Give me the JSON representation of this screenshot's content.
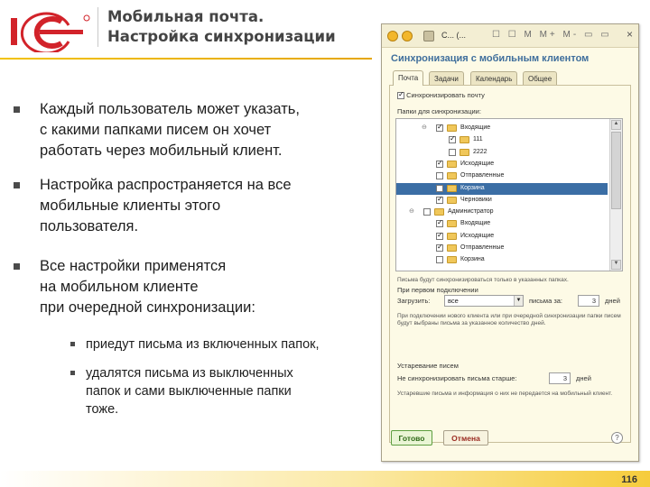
{
  "slide": {
    "title_line1": "Мобильная почта.",
    "title_line2": "Настройка синхронизации",
    "bullets": [
      "Каждый пользователь может указать,\nс какими папками писем он хочет\nработать через мобильный клиент.",
      "Настройка распространяется на все\nмобильные клиенты этого\nпользователя.",
      "Все настройки применятся\nна мобильном клиенте\nпри очередной синхронизации:"
    ],
    "sub_bullets": [
      "приедут письма из включенных папок,",
      "удалятся письма из выключенных\nпапок и сами выключенные папки\nтоже."
    ],
    "page_number": "116"
  },
  "window": {
    "title": "С... (...",
    "toolbar_icons": "☐ ☐ M M+ M- ▭ ▭",
    "form_title": "Синхронизация с мобильным клиентом",
    "tabs": [
      "Почта",
      "Задачи",
      "Календарь",
      "Общее"
    ],
    "sync_mail_label": "Синхронизировать почту",
    "folders_label": "Папки для синхронизации:",
    "tree": [
      {
        "label": "Входящие",
        "checked": true,
        "expander": "⊖",
        "selected": false
      },
      {
        "label": "111",
        "checked": true,
        "expander": "",
        "selected": false
      },
      {
        "label": "2222",
        "checked": false,
        "expander": "",
        "selected": false
      },
      {
        "label": "Исходящие",
        "checked": true,
        "expander": "",
        "selected": false
      },
      {
        "label": "Отправленные",
        "checked": false,
        "expander": "",
        "selected": false
      },
      {
        "label": "Корзина",
        "checked": false,
        "expander": "",
        "selected": true
      },
      {
        "label": "Черновики",
        "checked": true,
        "expander": "",
        "selected": false
      },
      {
        "label": "Администратор",
        "checked": false,
        "expander": "⊖",
        "selected": false
      },
      {
        "label": "Входящие",
        "checked": true,
        "expander": "",
        "selected": false
      },
      {
        "label": "Исходящие",
        "checked": true,
        "expander": "",
        "selected": false
      },
      {
        "label": "Отправленные",
        "checked": true,
        "expander": "",
        "selected": false
      },
      {
        "label": "Корзина",
        "checked": false,
        "expander": "",
        "selected": false
      }
    ],
    "tree_note": "Письма будут синхронизироваться только в указанных папках.",
    "first_connect_section": "При первом подключении",
    "load_label": "Загрузить:",
    "load_value": "все",
    "letters_for_label": "письма за:",
    "letters_days_value": "3",
    "days_label": "дней",
    "first_connect_note": "При подключении нового клиента или при очередной синхронизации папки писем будут выбраны письма за указанное количество дней.",
    "obsolete_section": "Устаревание писем",
    "no_sync_older_label": "Не синхронизировать письма старше:",
    "no_sync_days_value": "3",
    "obsolete_note": "Устаревшие письма и информация о них не передается на мобильный клиент.",
    "ok_button": "Готово",
    "cancel_button": "Отмена",
    "help_button": "?"
  },
  "colors": {
    "accent_yellow": "#f2c200",
    "logo_red": "#d2232a",
    "selection_blue": "#3b6ea5",
    "form_title_blue": "#3f6e9c"
  }
}
